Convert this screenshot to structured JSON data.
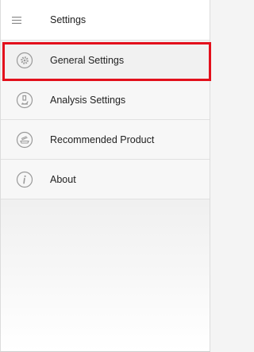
{
  "header": {
    "title": "Settings",
    "menu_icon": "hamburger-menu-icon"
  },
  "menu": {
    "items": [
      {
        "label": "General Settings",
        "icon": "gear-icon",
        "selected": true
      },
      {
        "label": "Analysis Settings",
        "icon": "microscope-icon",
        "selected": false
      },
      {
        "label": "Recommended Product",
        "icon": "product-icon",
        "selected": false
      },
      {
        "label": "About",
        "icon": "info-icon",
        "selected": false
      }
    ]
  },
  "colors": {
    "highlight": "#e3101c",
    "icon_gray": "#9a9a9a",
    "text": "#222222"
  }
}
